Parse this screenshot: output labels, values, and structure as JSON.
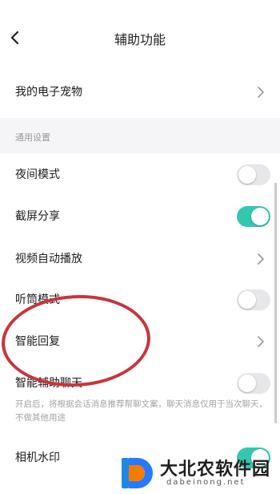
{
  "header": {
    "title": "辅助功能",
    "back_icon": "chevron-left-icon"
  },
  "rows": {
    "pet": {
      "label": "我的电子宠物"
    },
    "night": {
      "label": "夜间模式",
      "enabled": false
    },
    "screenshot": {
      "label": "截屏分享",
      "enabled": true
    },
    "autoplay": {
      "label": "视频自动播放"
    },
    "listen": {
      "label": "听筒模式",
      "enabled": false
    },
    "smart_reply": {
      "label": "智能回复"
    },
    "smart_chat": {
      "label": "智能辅助聊天",
      "enabled": false,
      "note": "开启后，将根据会话消息推荐帮聊文案，聊天消息仅用于当次聊天，不做其他用途"
    },
    "watermark": {
      "label": "相机水印",
      "enabled": true
    }
  },
  "section": {
    "title": "通用设置"
  },
  "watermark_brand": {
    "name": "大北农软件园",
    "url": "dabeinong.net"
  },
  "colors": {
    "toggle_on": "#33c7b0",
    "toggle_off": "#e7e7e9",
    "annotation": "#c8343e"
  }
}
